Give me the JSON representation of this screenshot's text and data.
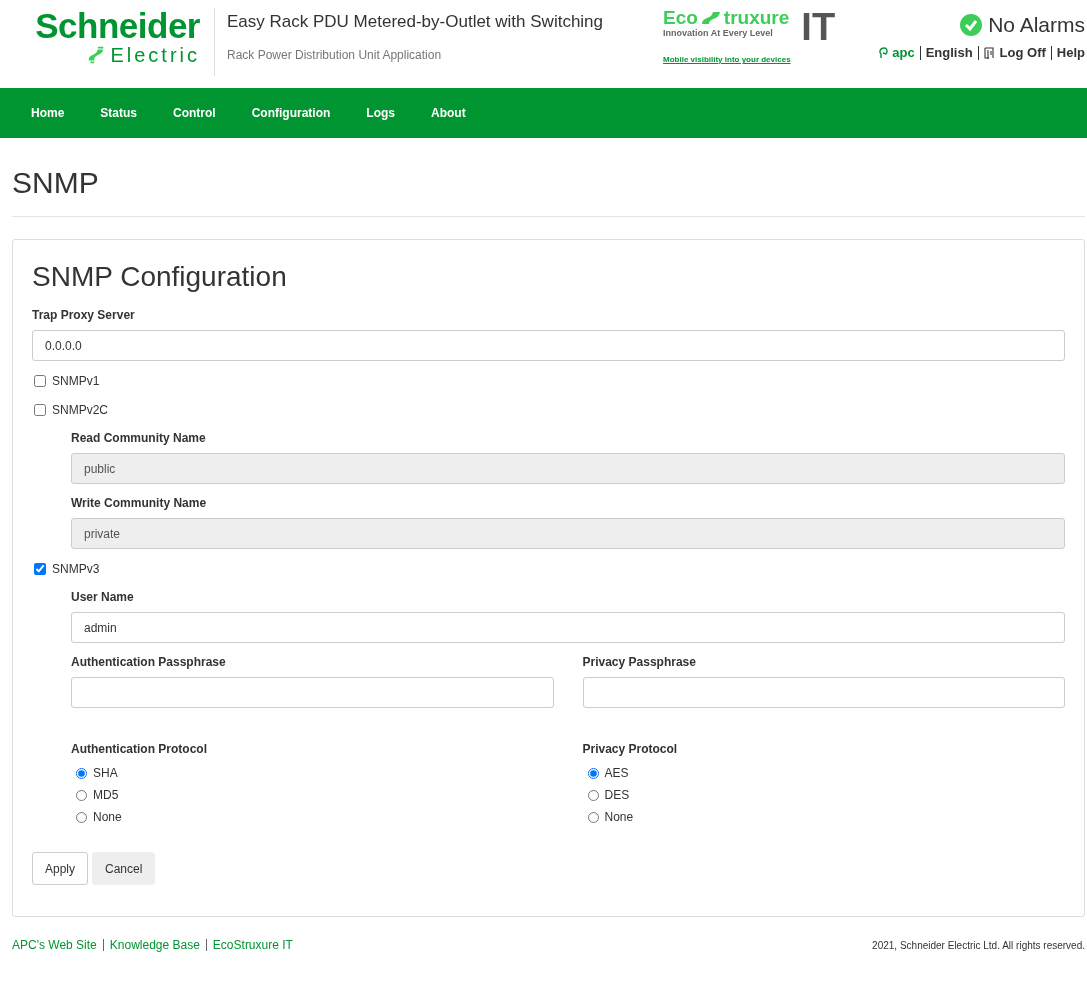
{
  "header": {
    "brand": {
      "name": "Schneider",
      "sub": "Electric"
    },
    "product_title": "Easy Rack PDU Metered-by-Outlet with Switching",
    "product_subtitle": "Rack Power Distribution Unit Application",
    "eco_logo": {
      "left": "Eco",
      "right": "truxure",
      "tagline": "Innovation At Every Level",
      "suffix": "IT"
    },
    "mobile_link": "Mobile visibility into your devices",
    "alarm_status": "No Alarms",
    "user_links": [
      {
        "kind": "user",
        "label": "apc"
      },
      {
        "kind": "plain",
        "label": "English"
      },
      {
        "kind": "logoff",
        "label": "Log Off"
      },
      {
        "kind": "plain",
        "label": "Help"
      }
    ]
  },
  "nav": {
    "items": [
      "Home",
      "Status",
      "Control",
      "Configuration",
      "Logs",
      "About"
    ]
  },
  "page_title": "SNMP",
  "panel": {
    "title": "SNMP Configuration",
    "form": [
      {
        "kind": "text",
        "label": "Trap Proxy Server",
        "value": "0.0.0.0",
        "disabled": false
      },
      {
        "kind": "checkbox",
        "label": "SNMPv1",
        "checked": false
      },
      {
        "kind": "checkbox",
        "label": "SNMPv2C",
        "checked": false,
        "children": [
          {
            "kind": "text",
            "label": "Read Community Name",
            "value": "public",
            "disabled": true
          },
          {
            "kind": "text",
            "label": "Write Community Name",
            "value": "private",
            "disabled": true
          }
        ]
      },
      {
        "kind": "checkbox",
        "label": "SNMPv3",
        "checked": true,
        "children": [
          {
            "kind": "text",
            "label": "User Name",
            "value": "admin",
            "disabled": false
          },
          {
            "kind": "pair",
            "items": [
              {
                "kind": "text",
                "label": "Authentication Passphrase",
                "disabled": false
              },
              {
                "kind": "text",
                "label": "Privacy Passphrase",
                "disabled": false
              }
            ]
          },
          {
            "kind": "pair",
            "items": [
              {
                "kind": "radio",
                "label": "Authentication Protocol",
                "options": [
                  {
                    "label": "SHA",
                    "selected": true
                  },
                  {
                    "label": "MD5",
                    "selected": false
                  },
                  {
                    "label": "None",
                    "selected": false
                  }
                ]
              },
              {
                "kind": "radio",
                "label": "Privacy Protocol",
                "options": [
                  {
                    "label": "AES",
                    "selected": true
                  },
                  {
                    "label": "DES",
                    "selected": false
                  },
                  {
                    "label": "None",
                    "selected": false
                  }
                ]
              }
            ]
          }
        ]
      }
    ],
    "buttons": [
      {
        "kind": "primary",
        "label": "Apply"
      },
      {
        "kind": "secondary",
        "label": "Cancel"
      }
    ]
  },
  "footer": {
    "links": [
      "APC's Web Site",
      "Knowledge Base",
      "EcoStruxure IT"
    ],
    "copyright": "2021, Schneider Electric Ltd. All rights reserved."
  }
}
